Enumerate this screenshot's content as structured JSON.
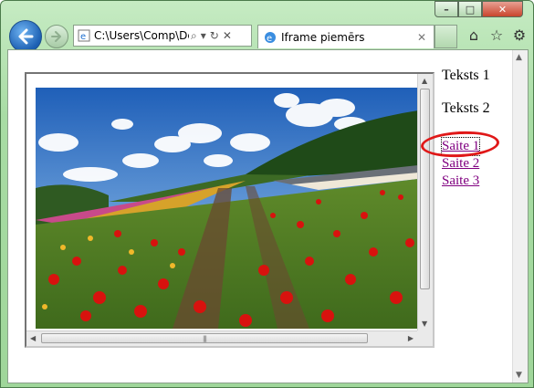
{
  "window": {
    "minimize": "–",
    "maximize": "□",
    "close": "✕"
  },
  "nav": {
    "back_icon": "back-arrow-icon",
    "forward_icon": "forward-arrow-icon"
  },
  "address": {
    "value": "C:\\Users\\Comp\\De",
    "tools": [
      "⌕",
      "▾",
      "↻",
      "✕"
    ]
  },
  "tab": {
    "title": "Iframe piemērs",
    "close": "✕"
  },
  "toolbar": {
    "home": "⌂",
    "favorites": "☆",
    "tools": "⚙"
  },
  "page": {
    "texts": [
      "Teksts 1",
      "Teksts 2"
    ],
    "links": [
      "Saite 1",
      "Saite 2",
      "Saite 3"
    ]
  },
  "colors": {
    "link_visited": "#800080",
    "highlight_ring": "#e01818"
  }
}
